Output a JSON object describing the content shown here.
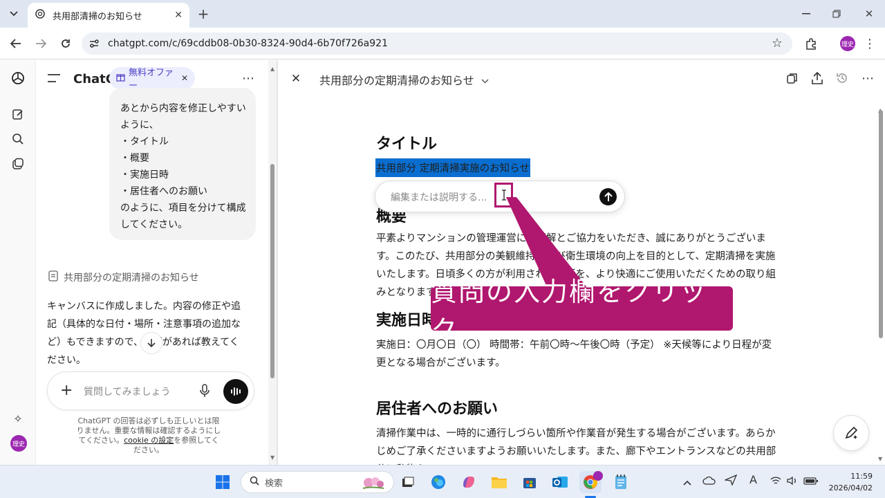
{
  "browser": {
    "tab_title": "共用部清掃のお知らせ",
    "url": "chatgpt.com/c/69cddb08-0b30-8324-90d4-6b70f726a921",
    "profile": "理史"
  },
  "chat": {
    "app_name": "ChatG",
    "offer_label": "無料オファー",
    "user_message_lines": [
      "あとから内容を修正しやすい",
      "ように、",
      "・タイトル",
      "・概要",
      "・実施日時",
      "・居住者へのお願い",
      "のように、項目を分けて構成",
      "してください。"
    ],
    "canvas_link": "共用部分の定期清掃のお知らせ",
    "assistant_reply": "キャンバスに作成しました。内容の修正や追記（具体的な日付・場所・注意事項の追加など）もできますので、必要があれば教えてください。",
    "composer_placeholder": "質問してみましょう",
    "disclaimer_1": "ChatGPT の回答は必ずしも正しいとは限りません。重要な情報は確認するようにしてください。",
    "disclaimer_link": "cookie の設定",
    "disclaimer_2": "を参照してください。",
    "profile": "理史"
  },
  "canvas": {
    "title": "共用部分の定期清掃のお知らせ",
    "h_title": "タイトル",
    "selected_text": "共用部分 定期清掃実施のお知らせ",
    "inline_placeholder": "編集または説明する...",
    "h_overview": "概要",
    "p_overview": "平素よりマンションの管理運営にご理解とご協力をいただき、誠にありがとうございます。このたび、共用部分の美観維持および衛生環境の向上を目的として、定期清掃を実施いたします。日頃多くの方が利用される場所を、より快適にご使用いただくための取り組みとなります。",
    "h_date": "実施日時",
    "p_date": "実施日：〇月〇日（〇） 時間帯：午前〇時～午後〇時（予定） ※天候等により日程が変更となる場合がございます。",
    "h_request": "居住者へのお願い",
    "p_request": "清掃作業中は、一時的に通行しづらい箇所や作業音が発生する場合がございます。あらかじめご了承くださいますようお願いいたします。また、廊下やエントランスなどの共用部分に私物を"
  },
  "callout": {
    "text": "質問の入力欄をクリック",
    "color": "#b0176e"
  },
  "taskbar": {
    "search_placeholder": "検索",
    "time": "11:59",
    "date": "2026/04/02"
  },
  "colors": {
    "selection": "#0a6ed1",
    "accent": "#b0176e"
  }
}
